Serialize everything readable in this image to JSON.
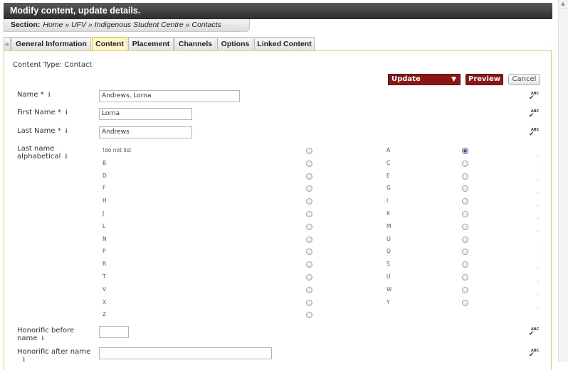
{
  "header": {
    "title": "Modify content, update details."
  },
  "breadcrumb": {
    "label": "Section:",
    "path": "Home » UFV » Indigenous Student Centre » Contacts"
  },
  "tabs": [
    {
      "label": "General Information",
      "active": false
    },
    {
      "label": "Content",
      "active": true
    },
    {
      "label": "Placement",
      "active": false
    },
    {
      "label": "Channels",
      "active": false
    },
    {
      "label": "Options",
      "active": false
    },
    {
      "label": "Linked Content",
      "active": false
    }
  ],
  "content_type": "Content Type: Contact",
  "actions": {
    "update": "Update",
    "preview": "Preview",
    "cancel": "Cancel"
  },
  "fields": {
    "name": {
      "label": "Name *",
      "value": "Andrews, Lorna"
    },
    "first_name": {
      "label": "First Name *",
      "value": "Lorna"
    },
    "last_name": {
      "label": "Last Name *",
      "value": "Andrews"
    },
    "alpha": {
      "label_line1": "Last name",
      "label_line2": "alphabetical"
    },
    "honorific_before": {
      "label_line1": "Honorific before",
      "label_line2": "name",
      "value": ""
    },
    "honorific_after": {
      "label": "Honorific after name",
      "value": ""
    }
  },
  "alpha_options": [
    {
      "label": "!do not list",
      "checked": false
    },
    {
      "label": "A",
      "checked": true
    },
    {
      "label": "B",
      "checked": false
    },
    {
      "label": "C",
      "checked": false
    },
    {
      "label": "D",
      "checked": false
    },
    {
      "label": "E",
      "checked": false
    },
    {
      "label": "F",
      "checked": false
    },
    {
      "label": "G",
      "checked": false
    },
    {
      "label": "H",
      "checked": false
    },
    {
      "label": "I",
      "checked": false
    },
    {
      "label": "J",
      "checked": false
    },
    {
      "label": "K",
      "checked": false
    },
    {
      "label": "L",
      "checked": false
    },
    {
      "label": "M",
      "checked": false
    },
    {
      "label": "N",
      "checked": false
    },
    {
      "label": "O",
      "checked": false
    },
    {
      "label": "P",
      "checked": false
    },
    {
      "label": "Q",
      "checked": false
    },
    {
      "label": "R",
      "checked": false
    },
    {
      "label": "S",
      "checked": false
    },
    {
      "label": "T",
      "checked": false
    },
    {
      "label": "U",
      "checked": false
    },
    {
      "label": "V",
      "checked": false
    },
    {
      "label": "W",
      "checked": false
    },
    {
      "label": "X",
      "checked": false
    },
    {
      "label": "Y",
      "checked": false
    },
    {
      "label": "Z",
      "checked": false
    }
  ],
  "icons": {
    "info": "i",
    "info_icon": "info-icon",
    "spellcheck_icon": "spellcheck-icon",
    "spell_abc": "ABC",
    "spell_check": "✔"
  },
  "colors": {
    "accent": "#8c1515",
    "tab_active": "#fdf6c9",
    "panel_border": "#e9cf6b",
    "info": "#3a63c8"
  }
}
